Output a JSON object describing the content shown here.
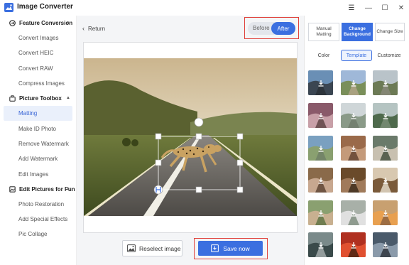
{
  "app": {
    "title": "Image Converter"
  },
  "window": {
    "menu": "☰",
    "minimize": "—",
    "maximize": "☐",
    "close": "✕"
  },
  "sidebar": {
    "sections": [
      {
        "label": "Feature Conversion",
        "items": [
          "Convert Images",
          "Convert HEIC",
          "Convert RAW",
          "Compress Images"
        ]
      },
      {
        "label": "Picture Toolbox",
        "items": [
          "Matting",
          "Make ID Photo",
          "Remove Watermark",
          "Add Watermark",
          "Edit Images"
        ]
      },
      {
        "label": "Edit Pictures for Fun",
        "items": [
          "Photo Restoration",
          "Add Special Effects",
          "Pic Collage"
        ]
      }
    ],
    "active_item": "Matting"
  },
  "main": {
    "return_label": "Return",
    "toggle": {
      "before": "Before",
      "after": "After",
      "selected": "After"
    },
    "reselect_label": "Reselect image",
    "save_label": "Save now"
  },
  "right_panel": {
    "modes": [
      {
        "line1": "Manual",
        "line2": "Matting"
      },
      {
        "line1": "Change",
        "line2": "Background"
      },
      {
        "line1": "Change Size",
        "line2": ""
      }
    ],
    "active_mode": "Change Background",
    "subtabs": [
      "Color",
      "Template",
      "Customize"
    ],
    "active_subtab": "Template"
  },
  "colors": {
    "accent": "#3b6fe0",
    "highlight_border": "#e0403a",
    "active_side_bg": "#eaf0fb"
  }
}
